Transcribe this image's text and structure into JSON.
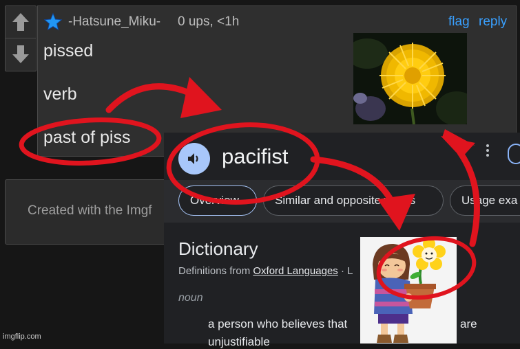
{
  "comment": {
    "username": "-Hatsune_Miku-",
    "meta": "0 ups, <1h",
    "flag": "flag",
    "reply": "reply",
    "lines": [
      "pissed",
      "verb",
      "past of piss"
    ]
  },
  "created_text": "Created with the Imgf",
  "dictionary": {
    "word": "pacifist",
    "chips": [
      "Overview",
      "Similar and opposite words",
      "Usage exa"
    ],
    "section_title": "Dictionary",
    "definitions_from_prefix": "Definitions from ",
    "source": "Oxford Languages",
    "source_suffix": " · L",
    "part_of_speech": "noun",
    "definition_part1": "a person who believes that",
    "definition_part2": "are",
    "definition_line2": "unjustifiable"
  },
  "watermark": "imgflip.com",
  "colors": {
    "accent_link": "#39a0ff",
    "annotation_red": "#e0141e",
    "speaker_blue": "#a8c7fa"
  },
  "icons": [
    "arrow-up-icon",
    "arrow-down-icon",
    "star-icon",
    "speaker-icon",
    "more-vert-icon"
  ]
}
